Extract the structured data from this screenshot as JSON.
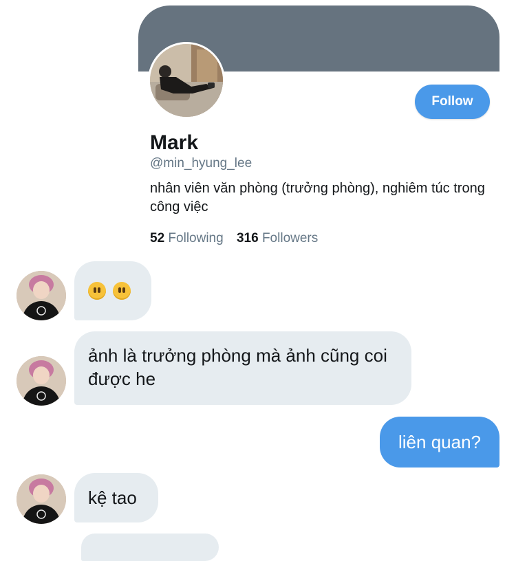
{
  "profile": {
    "name": "Mark",
    "handle": "@min_hyung_lee",
    "bio": "nhân viên văn phòng (trưởng phòng), nghiêm túc trong công việc",
    "follow_label": "Follow",
    "following_count": "52",
    "following_label": "Following",
    "followers_count": "316",
    "followers_label": "Followers",
    "banner_color": "#66737f",
    "accent_color": "#4a99e9"
  },
  "messages": [
    {
      "sender": "other",
      "text": "",
      "emoji": [
        "hushed-face-icon",
        "hushed-face-icon"
      ]
    },
    {
      "sender": "other",
      "text": "ảnh là trưởng phòng mà ảnh cũng coi được he"
    },
    {
      "sender": "me",
      "text": "liên quan?"
    },
    {
      "sender": "other",
      "text": "kệ tao"
    }
  ]
}
